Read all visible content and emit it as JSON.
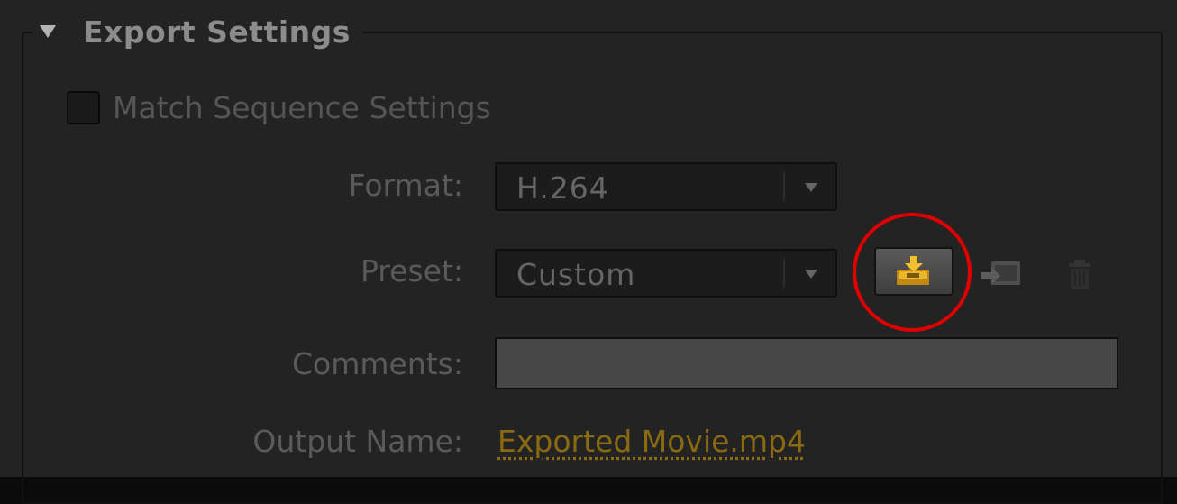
{
  "section": {
    "title": "Export Settings"
  },
  "match_sequence": {
    "label": "Match Sequence Settings",
    "checked": false
  },
  "format": {
    "label": "Format:",
    "value": "H.264"
  },
  "preset": {
    "label": "Preset:",
    "value": "Custom",
    "buttons": {
      "save": "save-preset-icon",
      "import": "import-preset-icon",
      "delete": "trash-icon"
    }
  },
  "comments": {
    "label": "Comments:",
    "value": ""
  },
  "output": {
    "label": "Output Name:",
    "value": "Exported Movie.mp4"
  },
  "colors": {
    "panel_bg": "#232323",
    "highlight_ring": "#e00000",
    "accent_icon": "#d9a521",
    "link": "#8a6a10"
  }
}
